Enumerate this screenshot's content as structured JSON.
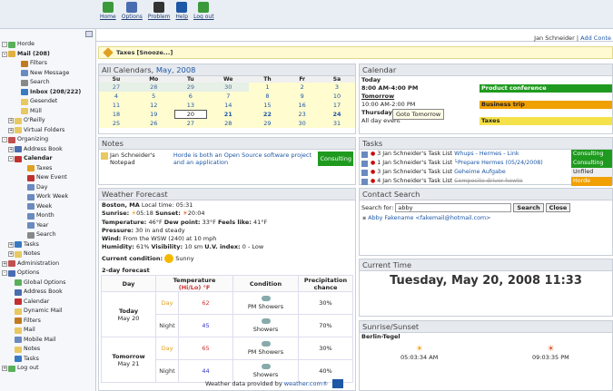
{
  "topnav": [
    {
      "label": "Home",
      "icon": "home-icon",
      "color": "#3a9a3a"
    },
    {
      "label": "Options",
      "icon": "options-icon",
      "color": "#4a6cb0"
    },
    {
      "label": "Problem",
      "icon": "problem-icon",
      "color": "#333333"
    },
    {
      "label": "Help",
      "icon": "help-icon",
      "color": "#1d57a6"
    },
    {
      "label": "Log out",
      "icon": "logout-icon",
      "color": "#3a9a3a"
    }
  ],
  "user": {
    "name": "Jan Schneider",
    "separator": "|",
    "add_content": "Add Conte"
  },
  "sidebar": [
    {
      "label": "Horde",
      "indent": 0,
      "exp": "-",
      "color": "#5ab05a"
    },
    {
      "label": "Mail (208)",
      "indent": 0,
      "exp": "-",
      "color": "#e0b040",
      "bold": true
    },
    {
      "label": "Filters",
      "indent": 2,
      "color": "#c07a20"
    },
    {
      "label": "New Message",
      "indent": 2,
      "color": "#6a8ac0"
    },
    {
      "label": "Search",
      "indent": 2,
      "color": "#888888"
    },
    {
      "label": "Inbox (208/222)",
      "indent": 2,
      "color": "#3a7ac0",
      "bold": true
    },
    {
      "label": "Gesendet",
      "indent": 2,
      "color": "#e8c860"
    },
    {
      "label": "Müll",
      "indent": 2,
      "color": "#e8c860"
    },
    {
      "label": "O'Reilly",
      "indent": 1,
      "exp": "+",
      "color": "#e8c860"
    },
    {
      "label": "Virtual Folders",
      "indent": 1,
      "exp": "+",
      "color": "#e8c860"
    },
    {
      "label": "Organizing",
      "indent": 0,
      "exp": "-",
      "color": "#c05050"
    },
    {
      "label": "Address Book",
      "indent": 1,
      "exp": "+",
      "color": "#4a6cb0"
    },
    {
      "label": "Calendar",
      "indent": 1,
      "exp": "-",
      "color": "#c03030",
      "bold": true
    },
    {
      "label": "Taxes",
      "indent": 3,
      "color": "#e0a020"
    },
    {
      "label": "New Event",
      "indent": 3,
      "color": "#c03030"
    },
    {
      "label": "Day",
      "indent": 3,
      "color": "#6a8ac0"
    },
    {
      "label": "Work Week",
      "indent": 3,
      "color": "#6a8ac0"
    },
    {
      "label": "Week",
      "indent": 3,
      "color": "#6a8ac0"
    },
    {
      "label": "Month",
      "indent": 3,
      "color": "#6a8ac0"
    },
    {
      "label": "Year",
      "indent": 3,
      "color": "#6a8ac0"
    },
    {
      "label": "Search",
      "indent": 3,
      "color": "#888888"
    },
    {
      "label": "Tasks",
      "indent": 1,
      "exp": "+",
      "color": "#3a7ac0"
    },
    {
      "label": "Notes",
      "indent": 1,
      "exp": "+",
      "color": "#e8c860"
    },
    {
      "label": "Administration",
      "indent": 0,
      "exp": "+",
      "color": "#c05050"
    },
    {
      "label": "Options",
      "indent": 0,
      "exp": "-",
      "color": "#4a6cb0"
    },
    {
      "label": "Global Options",
      "indent": 1,
      "color": "#5ab05a"
    },
    {
      "label": "Address Book",
      "indent": 1,
      "color": "#4a6cb0"
    },
    {
      "label": "Calendar",
      "indent": 1,
      "color": "#c03030"
    },
    {
      "label": "Dynamic Mail",
      "indent": 1,
      "color": "#e8c860"
    },
    {
      "label": "Filters",
      "indent": 1,
      "color": "#c07a20"
    },
    {
      "label": "Mail",
      "indent": 1,
      "color": "#e8c860"
    },
    {
      "label": "Mobile Mail",
      "indent": 1,
      "color": "#6a8ac0"
    },
    {
      "label": "Notes",
      "indent": 1,
      "color": "#e8c860"
    },
    {
      "label": "Tasks",
      "indent": 1,
      "color": "#3a7ac0"
    },
    {
      "label": "Log out",
      "indent": 0,
      "exp": "+",
      "color": "#5ab05a"
    }
  ],
  "taskbar": {
    "label": "Taxes",
    "tag": "[Snooze...]"
  },
  "calendar": {
    "title": "All Calendars,",
    "month": "May, 2008",
    "days": [
      "Su",
      "Mo",
      "Tu",
      "We",
      "Th",
      "Fr",
      "Sa"
    ],
    "weeks": [
      [
        [
          "27",
          "oth"
        ],
        [
          "28",
          "oth"
        ],
        [
          "29",
          "oth"
        ],
        [
          "30",
          "oth"
        ],
        [
          "1",
          "cur"
        ],
        [
          "2",
          "cur"
        ],
        [
          "3",
          "cur"
        ]
      ],
      [
        [
          "4",
          "cur"
        ],
        [
          "5",
          "cur"
        ],
        [
          "6",
          "cur"
        ],
        [
          "7",
          "cur"
        ],
        [
          "8",
          "cur"
        ],
        [
          "9",
          "cur"
        ],
        [
          "10",
          "cur"
        ]
      ],
      [
        [
          "11",
          "cur"
        ],
        [
          "12",
          "cur"
        ],
        [
          "13",
          "cur"
        ],
        [
          "14",
          "cur"
        ],
        [
          "15",
          "cur"
        ],
        [
          "16",
          "cur"
        ],
        [
          "17",
          "cur"
        ]
      ],
      [
        [
          "18",
          "cur"
        ],
        [
          "19",
          "cur"
        ],
        [
          "20",
          "today"
        ],
        [
          "21",
          "cur bold"
        ],
        [
          "22",
          "cur bold"
        ],
        [
          "23",
          "cur"
        ],
        [
          "24",
          "cur bold"
        ]
      ],
      [
        [
          "25",
          "cur"
        ],
        [
          "26",
          "cur"
        ],
        [
          "27",
          "cur"
        ],
        [
          "28",
          "cur"
        ],
        [
          "29",
          "cur"
        ],
        [
          "30",
          "cur"
        ],
        [
          "31",
          "cur"
        ]
      ]
    ]
  },
  "agenda": {
    "title": "Calendar",
    "today": "Today",
    "today_time": "8:00 AM-4:00 PM",
    "today_event": "Product conference",
    "tomorrow": "Tomorrow",
    "tomorrow_time": "10:00 AM-2:00 PM",
    "tomorrow_event": "Business trip",
    "thursday": "Thursday",
    "allday": "All day event",
    "allday_event": "Taxes",
    "tooltip": "Goto Tomorrow",
    "green": "#1f9a1f",
    "orange": "#f0a000",
    "yellow": "#f5e24a"
  },
  "notes": {
    "title": "Notes",
    "owner": "Jan Schneider's Notepad",
    "text": "Horde is both an Open Source software project and an application",
    "category": "Consulting"
  },
  "tasks": {
    "title": "Tasks",
    "items": [
      {
        "prio": "3",
        "list": "Jan Schneider's Task List",
        "name": "Whups - Hermes - Link",
        "cat": "Consulting",
        "catcolor": "#1f9a1f"
      },
      {
        "prio": "1",
        "list": "Jan Schneider's Task List",
        "name": "└Prepare Hermes (05/24/2008)",
        "cat": "Consulting",
        "catcolor": "#1f9a1f"
      },
      {
        "prio": "3",
        "list": "Jan Schneider's Task List",
        "name": "Geheime Aufgabe",
        "cat": "Unfiled",
        "catcolor": "#eeeeee"
      },
      {
        "prio": "4",
        "list": "Jan Schneider's Task List",
        "name": "Composite driver howto",
        "cat": "Horde",
        "catcolor": "#f0a000"
      }
    ]
  },
  "weather": {
    "title": "Weather Forecast",
    "location": "Boston, MA",
    "local_time_label": "Local time:",
    "local_time": "05:31",
    "sunrise_label": "Sunrise:",
    "sunrise": "05:18",
    "sunset_label": "Sunset:",
    "sunset": "20:04",
    "temperature_label": "Temperature:",
    "temperature": "46°F",
    "dew_label": "Dew point:",
    "dew": "33°F",
    "feels_label": "Feels like:",
    "feels": "41°F",
    "pressure_label": "Pressure:",
    "pressure": "30 in and steady",
    "wind_label": "Wind:",
    "wind": "From the WSW (240) at 10 mph",
    "humidity_label": "Humidity:",
    "humidity": "61%",
    "visibility_label": "Visibility:",
    "visibility": "10 sm",
    "uv_label": "U.V. index:",
    "uv": "0 - Low",
    "condition_label": "Current condition:",
    "condition": "Sunny",
    "forecast_title": "2-day forecast",
    "col_day": "Day",
    "col_temp": "Temperature",
    "col_temp_hilo": "(Hi/Lo) °F",
    "col_cond": "Condition",
    "col_precip": "Precipitation chance",
    "rows": [
      {
        "day": "Today",
        "date": "May 20",
        "half": "Day",
        "temp": "62",
        "cond": "PM Showers",
        "precip": "30%"
      },
      {
        "day": "",
        "date": "",
        "half": "Night",
        "temp": "45",
        "cond": "Showers",
        "precip": "70%"
      },
      {
        "day": "Tomorrow",
        "date": "May 21",
        "half": "Day",
        "temp": "65",
        "cond": "PM Showers",
        "precip": "30%"
      },
      {
        "day": "",
        "date": "",
        "half": "Night",
        "temp": "44",
        "cond": "Showers",
        "precip": "40%"
      }
    ],
    "provided_by": "Weather data provided by",
    "provider": "weather.com®"
  },
  "contact": {
    "title": "Contact Search",
    "label": "Search for:",
    "value": "abby",
    "search_btn": "Search",
    "close_btn": "Close",
    "result": "Abby Fakename <fakemail@hotmail.com>"
  },
  "current_time": {
    "title": "Current Time",
    "value": "Tuesday, May 20, 2008 11:33"
  },
  "sun": {
    "title": "Sunrise/Sunset",
    "location": "Berlin-Tegel",
    "sunrise": "05:03:34 AM",
    "sunset": "09:03:35 PM"
  }
}
